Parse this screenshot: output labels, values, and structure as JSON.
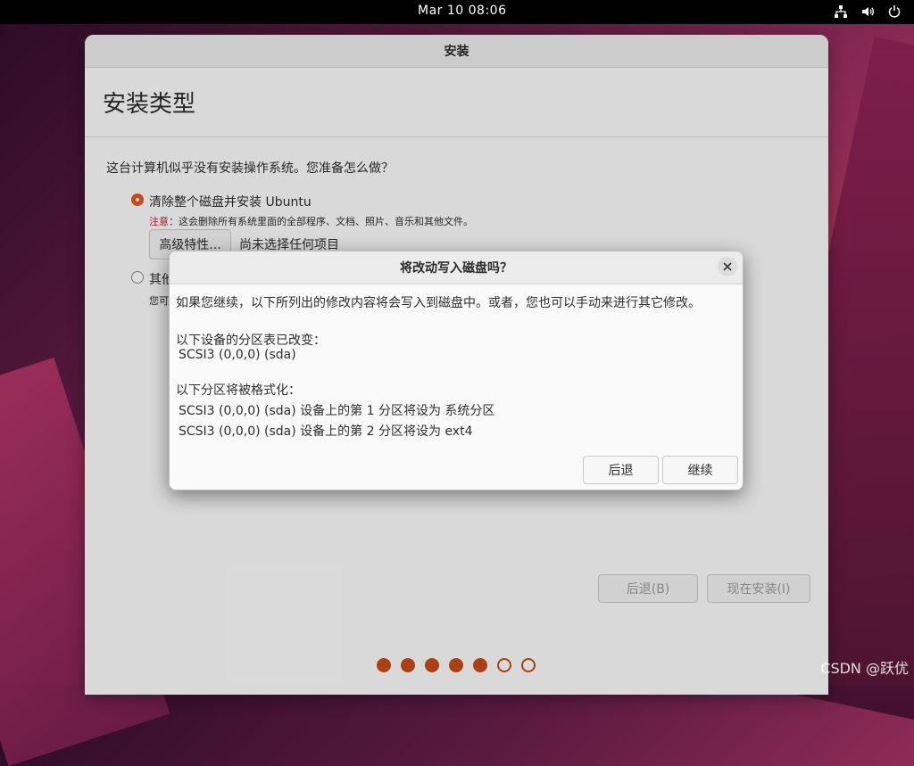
{
  "topbar": {
    "clock": "Mar 10  08:06",
    "icons": [
      "network-icon",
      "volume-icon",
      "power-icon"
    ]
  },
  "window": {
    "title": "安装",
    "heading": "安装类型",
    "question": "这台计算机似乎没有安装操作系统。您准备怎么做？",
    "option1": {
      "label": "清除整个磁盘并安装 Ubuntu",
      "checked": true,
      "note_warn": "注意",
      "note_text": "：这会删除所有系统里面的全部程序、文档、照片、音乐和其他文件。",
      "advanced_button": "高级特性...",
      "advanced_status": "尚未选择任何项目"
    },
    "option2": {
      "label": "其他",
      "checked": false,
      "note": "您可"
    },
    "back_button": "后退(B)",
    "install_button": "现在安装(I)",
    "progress_dots": {
      "total": 7,
      "filled": 5
    },
    "accent_color": "#e95420"
  },
  "dialog": {
    "title": "将改动写入磁盘吗？",
    "intro": "如果您继续，以下所列出的修改内容将会写入到磁盘中。或者，您也可以手动来进行其它修改。",
    "partition_table_heading": "以下设备的分区表已改变：",
    "partition_table_devices": [
      "SCSI3 (0,0,0) (sda)"
    ],
    "format_heading": "以下分区将被格式化：",
    "format_items": [
      "SCSI3 (0,0,0) (sda) 设备上的第 1 分区将设为 系统分区",
      "SCSI3 (0,0,0) (sda) 设备上的第 2 分区将设为 ext4"
    ],
    "back_button": "后退",
    "continue_button": "继续"
  },
  "watermark": "CSDN @跃优"
}
